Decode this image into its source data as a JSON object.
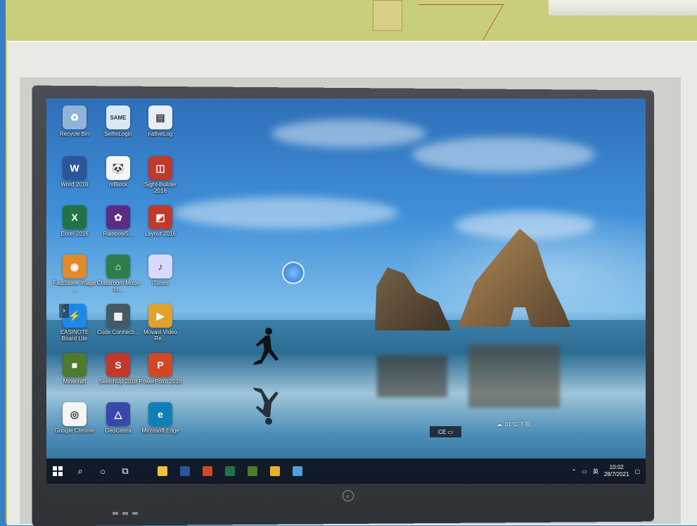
{
  "desktop": {
    "icons": [
      {
        "label": "Recycle Bin",
        "name": "recycle-bin",
        "color": "#8fb3d9",
        "glyph": "♻"
      },
      {
        "label": "SelfieLogin",
        "name": "same-login",
        "color": "#d9e8f5",
        "glyph": "SAME"
      },
      {
        "label": "nativeLog",
        "name": "native-log",
        "color": "#e8eef5",
        "glyph": "▤"
      },
      {
        "label": "Word 2016",
        "name": "word-2016",
        "color": "#2b579a",
        "glyph": "W"
      },
      {
        "label": "mBlock",
        "name": "mblock",
        "color": "#f5f5f5",
        "glyph": "🐼"
      },
      {
        "label": "Sight-Builder 2016",
        "name": "sight-builder",
        "color": "#c0392b",
        "glyph": "◫"
      },
      {
        "label": "Excel 2016",
        "name": "excel-2016",
        "color": "#217346",
        "glyph": "X"
      },
      {
        "label": "RainbowS...",
        "name": "rainbows",
        "color": "#5b2c83",
        "glyph": "✿"
      },
      {
        "label": "Layout 2016",
        "name": "layout-2016",
        "color": "#c0392b",
        "glyph": "◩"
      },
      {
        "label": "FastStone Image ...",
        "name": "faststone",
        "color": "#e08a2b",
        "glyph": "◉"
      },
      {
        "label": "Classroom Mode fo...",
        "name": "classroom-mode",
        "color": "#2e7d4f",
        "glyph": "⌂"
      },
      {
        "label": "iTunes",
        "name": "itunes",
        "color": "#d9d9ff",
        "glyph": "♪"
      },
      {
        "label": "EASINOTE Board Lite",
        "name": "easinote",
        "color": "#1e88e5",
        "glyph": "⚡"
      },
      {
        "label": "Code Connecti...",
        "name": "code-connection",
        "color": "#455a64",
        "glyph": "▦"
      },
      {
        "label": "Movavi Video Re...",
        "name": "movavi",
        "color": "#e0a22b",
        "glyph": "▶"
      },
      {
        "label": "Minecraft",
        "name": "minecraft",
        "color": "#4e7a2b",
        "glyph": "■"
      },
      {
        "label": "SketchUp 2018",
        "name": "sketchup",
        "color": "#c0392b",
        "glyph": "S"
      },
      {
        "label": "PowerPoint 2016",
        "name": "powerpoint-2016",
        "color": "#d24726",
        "glyph": "P"
      },
      {
        "label": "Google Chrome",
        "name": "google-chrome",
        "color": "#f5f5f5",
        "glyph": "◎"
      },
      {
        "label": "GeoGebra",
        "name": "geogebra",
        "color": "#3949ab",
        "glyph": "△"
      },
      {
        "label": "Microsoft Edge",
        "name": "microsoft-edge",
        "color": "#0f7fb6",
        "glyph": "e"
      }
    ]
  },
  "overlay": {
    "label": "CE ▭"
  },
  "weather": {
    "icon": "cloud-rain-icon",
    "text": "31°C 下雨"
  },
  "tray": {
    "time": "10:02",
    "date": "28/7/2021",
    "lang": "英"
  },
  "taskbar": {
    "apps": [
      {
        "name": "file-explorer",
        "color": "#f0c040"
      },
      {
        "name": "word",
        "color": "#2b579a"
      },
      {
        "name": "powerpoint",
        "color": "#d24726"
      },
      {
        "name": "excel",
        "color": "#217346"
      },
      {
        "name": "minecraft",
        "color": "#4e7a2b"
      },
      {
        "name": "chrome",
        "color": "#e8b32b"
      },
      {
        "name": "screen-tool",
        "color": "#4aa3e0"
      }
    ]
  }
}
